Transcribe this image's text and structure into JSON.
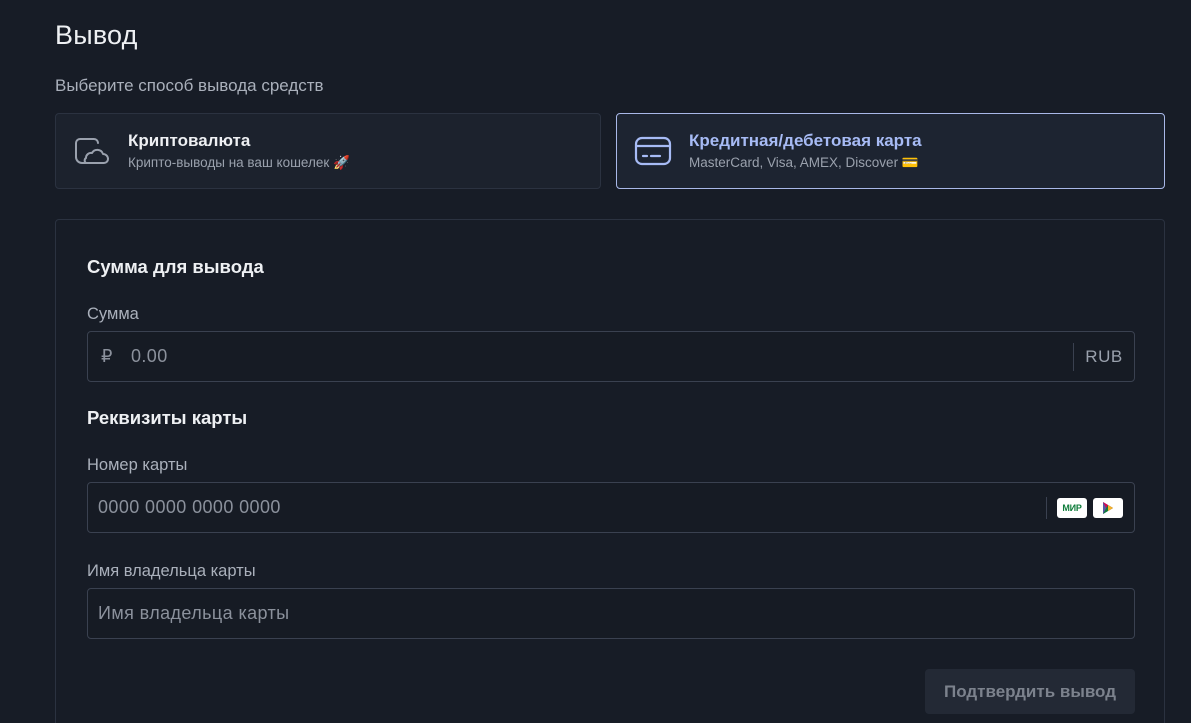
{
  "page": {
    "title": "Вывод",
    "subtitle": "Выберите способ вывода средств"
  },
  "methods": [
    {
      "title": "Криптовалюта",
      "subtitle": "Крипто-выводы на ваш кошелек 🚀",
      "icon": "wallet-cloud-icon",
      "selected": false
    },
    {
      "title": "Кредитная/дебетовая карта",
      "subtitle": "MasterCard, Visa, AMEX, Discover 💳",
      "icon": "credit-card-icon",
      "selected": true
    }
  ],
  "form": {
    "amount_section_title": "Сумма для вывода",
    "amount_label": "Сумма",
    "amount_currency_symbol": "₽",
    "amount_placeholder": "0.00",
    "amount_suffix": "RUB",
    "card_section_title": "Реквизиты карты",
    "card_number_label": "Номер карты",
    "card_number_placeholder": "0000 0000 0000 0000",
    "card_badges": [
      "МИР",
      ""
    ],
    "holder_label": "Имя владельца карты",
    "holder_placeholder": "Имя владельца карты",
    "submit_label": "Подтвердить вывод"
  },
  "colors": {
    "background": "#171c26",
    "selected_border": "#a9b8e8",
    "selected_title": "#a7bbf5",
    "mir_green": "#0f7d3b"
  }
}
